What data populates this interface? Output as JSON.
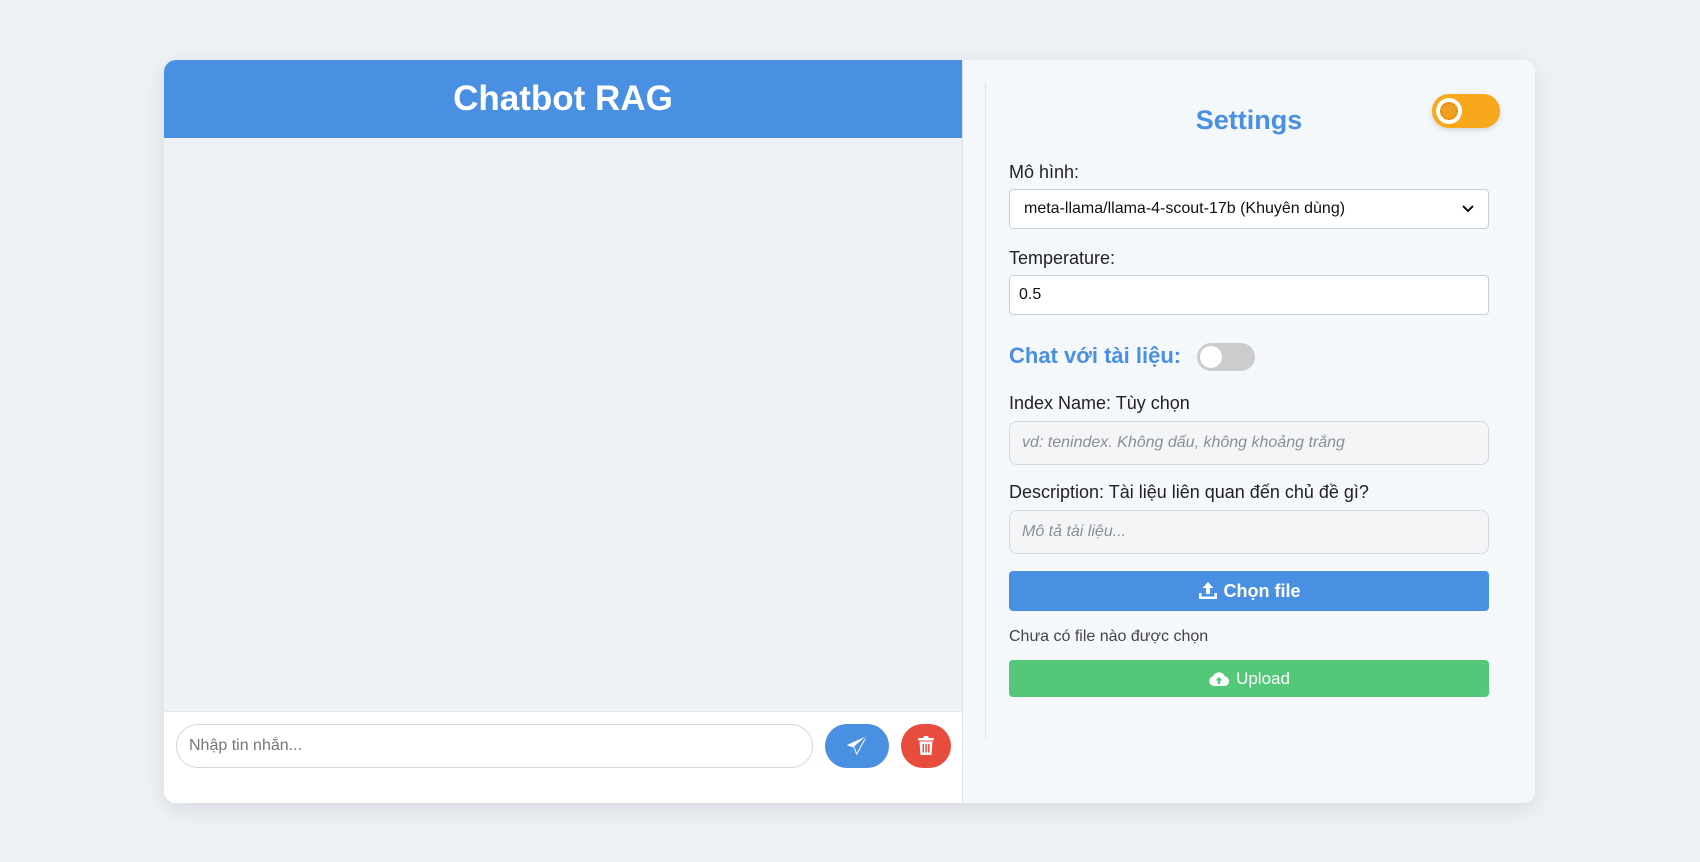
{
  "chat": {
    "title": "Chatbot RAG",
    "input_placeholder": "Nhập tin nhắn...",
    "send_icon": "paper-plane-icon",
    "clear_icon": "trash-icon"
  },
  "settings": {
    "title": "Settings",
    "theme_toggle_icon": "sun-icon",
    "model_label": "Mô hình:",
    "model_selected": "meta-llama/llama-4-scout-17b (Khuyên dùng)",
    "temperature_label": "Temperature:",
    "temperature_value": "0.5",
    "chat_with_docs_label": "Chat với tài liệu:",
    "index_label": "Index Name: Tùy chọn",
    "index_placeholder": "vd: tenindex. Không dấu, không khoảng trắng",
    "description_label": "Description: Tài liệu liên quan đến chủ đề gì?",
    "description_placeholder": "Mô tả tài liệu...",
    "choose_file_label": "Chọn file",
    "no_file_text": "Chưa có file nào được chọn",
    "upload_label": "Upload"
  },
  "colors": {
    "primary": "#4a90e2",
    "danger": "#e74c3c",
    "success": "#52c878",
    "toggle_on": "#f7a81b"
  }
}
